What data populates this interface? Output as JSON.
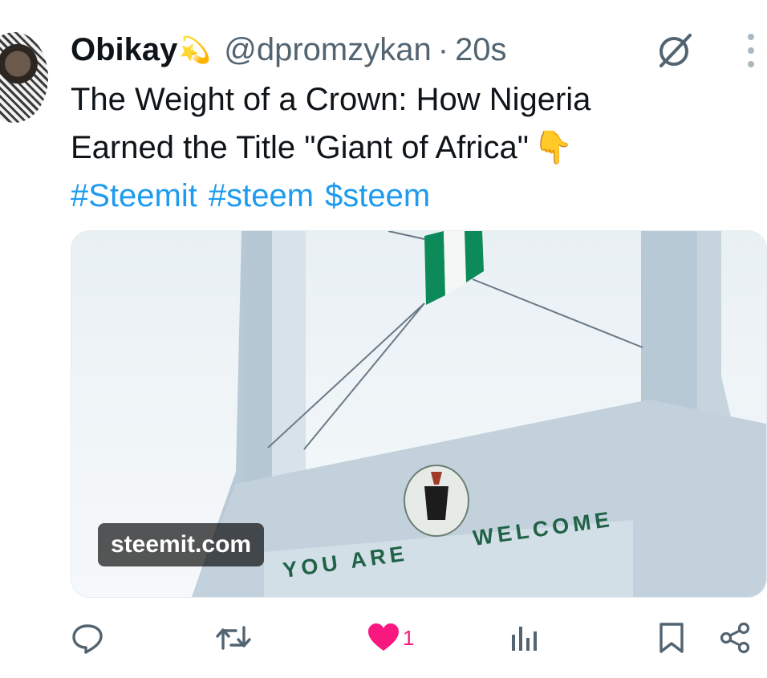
{
  "tweet": {
    "author": {
      "display_name": "Obikay",
      "name_emoji": "💫",
      "handle": "@dpromzykan",
      "separator": "·",
      "timestamp": "20s"
    },
    "text_line_1": "The Weight of a Crown: How Nigeria",
    "text_line_2": "Earned the Title \"Giant of Africa\"",
    "text_emoji": "👇",
    "hashtags": [
      "#Steemit",
      "#steem",
      "$steem"
    ]
  },
  "media": {
    "domain_label": "steemit.com",
    "sign_text_left": "YOU ARE",
    "sign_text_right": "WELCOME"
  },
  "actions": {
    "icons": [
      "reply-icon",
      "repost-icon",
      "like-icon",
      "views-icon",
      "bookmark-icon",
      "share-icon"
    ],
    "like_count": "1"
  },
  "colors": {
    "link": "#1d9bf0",
    "like": "#f91880",
    "secondary": "#536471"
  }
}
